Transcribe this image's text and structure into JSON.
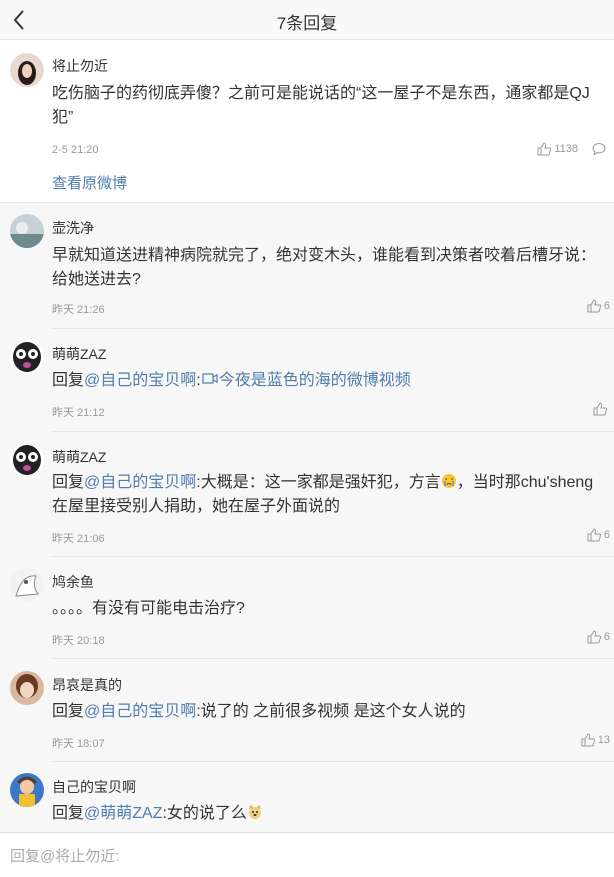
{
  "header": {
    "title": "7条回复"
  },
  "main_post": {
    "username": "将止勿近",
    "text": "吃伤脑子的药彻底弄傻？之前可是能说话的“这一屋子不是东西，通家都是QJ犯”",
    "time": "2-5 21:20",
    "likes": "1138",
    "view_original": "查看原微博"
  },
  "replies": [
    {
      "username": "壶洗净",
      "text": "早就知道送进精神病院就完了，绝对变木头，谁能看到决策者咬着后槽牙说：给她送进去?",
      "time": "昨天 21:26",
      "likes": "6"
    },
    {
      "username": "萌萌ZAZ",
      "prefix": "回复",
      "mention": "@自己的宝贝啊",
      "colon": ":",
      "video_label": "今夜是蓝色的海的微博视频",
      "time": "昨天 21:12",
      "likes": ""
    },
    {
      "username": "萌萌ZAZ",
      "prefix": "回复",
      "mention": "@自己的宝贝啊",
      "text_a": ":大概是：这一家都是强奸犯，方言",
      "text_b": "，当时那chu'sheng在屋里接受别人捐助，她在屋子外面说的",
      "time": "昨天 21:06",
      "likes": "6"
    },
    {
      "username": "鸠余鱼",
      "text": "。。。。有没有可能电击治疗?",
      "time": "昨天 20:18",
      "likes": "6"
    },
    {
      "username": "昂哀是真的",
      "prefix": "回复",
      "mention": "@自己的宝贝啊",
      "text": ":说了的 之前很多视频 是这个女人说的",
      "time": "昨天 18:07",
      "likes": "13"
    },
    {
      "username": "自己的宝贝啊",
      "prefix": "回复",
      "mention": "@萌萌ZAZ",
      "text": ":女的说了么"
    }
  ],
  "reply_box": {
    "placeholder": "回复@将止勿近:"
  },
  "colors": {
    "link": "#507daf",
    "text": "#333333",
    "meta": "#999999"
  }
}
